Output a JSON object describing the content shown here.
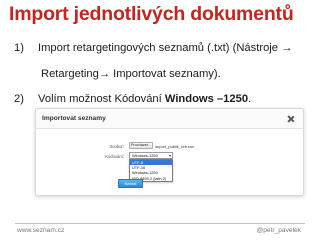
{
  "slide": {
    "title": "Import jednotlivých dokumentů",
    "steps": [
      {
        "number": "1)",
        "text_line1": "Import retargetingových seznamů (.txt) (Nástroje →",
        "text_line2": "Retargeting→ Importovat seznamy)."
      },
      {
        "number": "2)",
        "text_prefix": "Volím možnost Kódování ",
        "text_bold": "Windows –1250",
        "text_suffix": "."
      }
    ],
    "footer": {
      "left": "www.seznam.cz",
      "right": "@petr_pavelek"
    }
  },
  "dialog": {
    "title": "Importovat seznamy",
    "close_icon": "close-icon",
    "file_label": "Soubor:",
    "file_button": "Procházet...",
    "file_name": "import_publik_retr.csv",
    "encoding_label": "Kódování:",
    "encoding_selected": "Windows-1250",
    "encoding_options": [
      "UTF-8",
      "UTF-16",
      "Windows-1250",
      "ISO-8859-2 (latin 2)"
    ],
    "highlighted_option_index": 0,
    "import_button": "Nahrát soubor"
  },
  "colors": {
    "title": "#c8231c",
    "accent_button": "#2e8bd0",
    "option_highlight": "#3875d7"
  }
}
